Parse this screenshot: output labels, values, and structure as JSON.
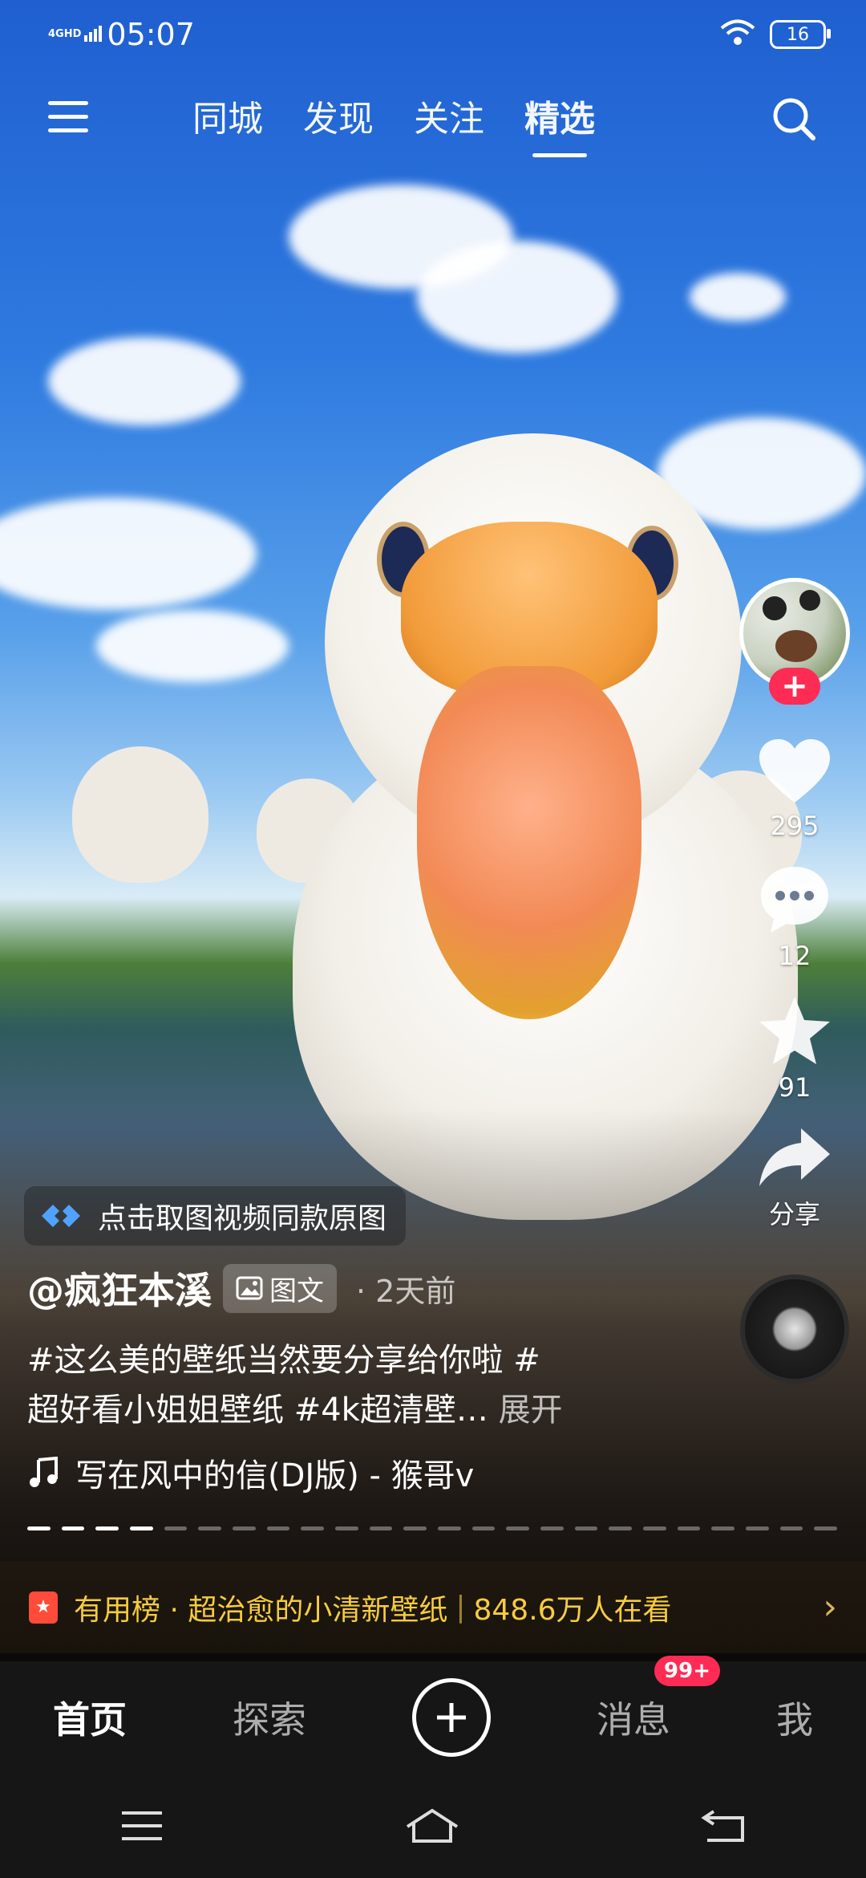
{
  "status_bar": {
    "network": "4GHD",
    "time": "05:07",
    "battery": "16"
  },
  "top_nav": {
    "tabs": [
      "同城",
      "发现",
      "关注",
      "精选"
    ],
    "active_tab": "精选"
  },
  "actions": {
    "likes": "295",
    "comments": "12",
    "favorites": "91",
    "share_label": "分享",
    "follow_symbol": "+"
  },
  "post": {
    "promo_text": "点击取图视频同款原图",
    "author": "@疯狂本溪",
    "type_chip": "图文",
    "time_ago": "2天前",
    "description_line1": "#这么美的壁纸当然要分享给你啦 #",
    "description_line2": "超好看小姐姐壁纸 #4k超清壁…",
    "expand_label": "展开",
    "music": "写在风中的信(DJ版) - 猴哥v",
    "progress": {
      "segments": 24,
      "viewed": 4
    }
  },
  "hot_banner": {
    "prefix": "有用榜 · 超治愈的小清新壁纸",
    "viewers": "848.6万人在看"
  },
  "bottom_tabs": {
    "home": "首页",
    "explore": "探索",
    "messages": "消息",
    "messages_badge": "99+",
    "me": "我"
  },
  "colors": {
    "accent": "#fe2c55",
    "banner_text": "#f7cc3f"
  }
}
